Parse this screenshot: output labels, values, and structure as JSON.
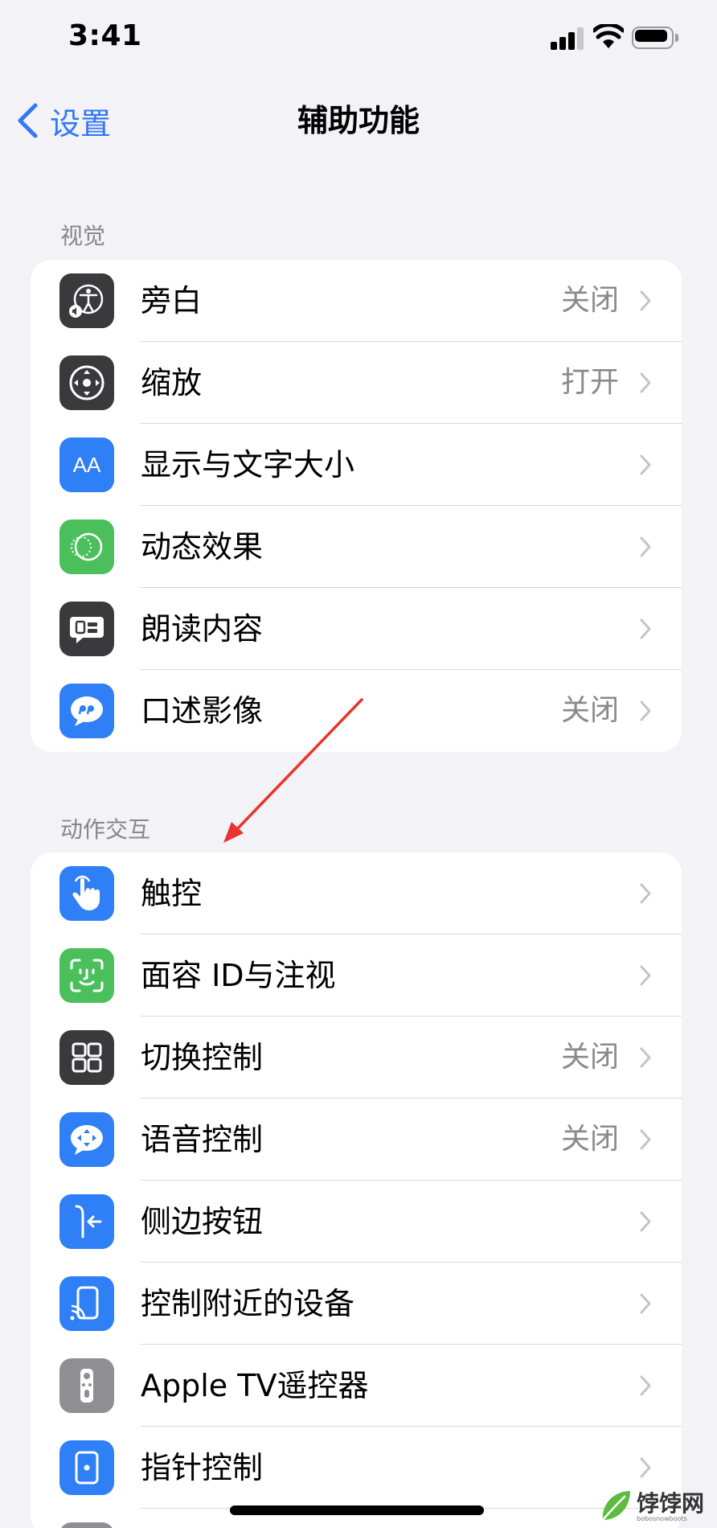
{
  "status_bar": {
    "time": "3:41"
  },
  "nav": {
    "back_label": "设置",
    "title": "辅助功能"
  },
  "sections": [
    {
      "header": "视觉",
      "rows": [
        {
          "label": "旁白",
          "value": "关闭",
          "icon": "voiceover-icon",
          "icon_bg": "#3a3a3c"
        },
        {
          "label": "缩放",
          "value": "打开",
          "icon": "zoom-icon",
          "icon_bg": "#3a3a3c"
        },
        {
          "label": "显示与文字大小",
          "value": "",
          "icon": "display-text-size-icon",
          "icon_bg": "#2f7ff6"
        },
        {
          "label": "动态效果",
          "value": "",
          "icon": "motion-icon",
          "icon_bg": "#4cbf5d"
        },
        {
          "label": "朗读内容",
          "value": "",
          "icon": "spoken-content-icon",
          "icon_bg": "#3a3a3c"
        },
        {
          "label": "口述影像",
          "value": "关闭",
          "icon": "audio-descriptions-icon",
          "icon_bg": "#2f7ff6"
        }
      ]
    },
    {
      "header": "动作交互",
      "rows": [
        {
          "label": "触控",
          "value": "",
          "icon": "touch-icon",
          "icon_bg": "#2f7ff6"
        },
        {
          "label": "面容 ID与注视",
          "value": "",
          "icon": "face-id-icon",
          "icon_bg": "#4cbf5d"
        },
        {
          "label": "切换控制",
          "value": "关闭",
          "icon": "switch-control-icon",
          "icon_bg": "#3a3a3c"
        },
        {
          "label": "语音控制",
          "value": "关闭",
          "icon": "voice-control-icon",
          "icon_bg": "#2f7ff6"
        },
        {
          "label": "侧边按钮",
          "value": "",
          "icon": "side-button-icon",
          "icon_bg": "#2f7ff6"
        },
        {
          "label": "控制附近的设备",
          "value": "",
          "icon": "nearby-devices-icon",
          "icon_bg": "#2f7ff6"
        },
        {
          "label": "Apple TV遥控器",
          "value": "",
          "icon": "apple-tv-remote-icon",
          "icon_bg": "#8e8e93"
        },
        {
          "label": "指针控制",
          "value": "",
          "icon": "pointer-control-icon",
          "icon_bg": "#2f7ff6"
        }
      ]
    }
  ],
  "colors": {
    "accent": "#3478f6",
    "background": "#f2f2f7",
    "annotation_arrow": "#e8332e"
  },
  "watermark": {
    "text": "饽饽网",
    "sub": "bobosnowboots"
  }
}
